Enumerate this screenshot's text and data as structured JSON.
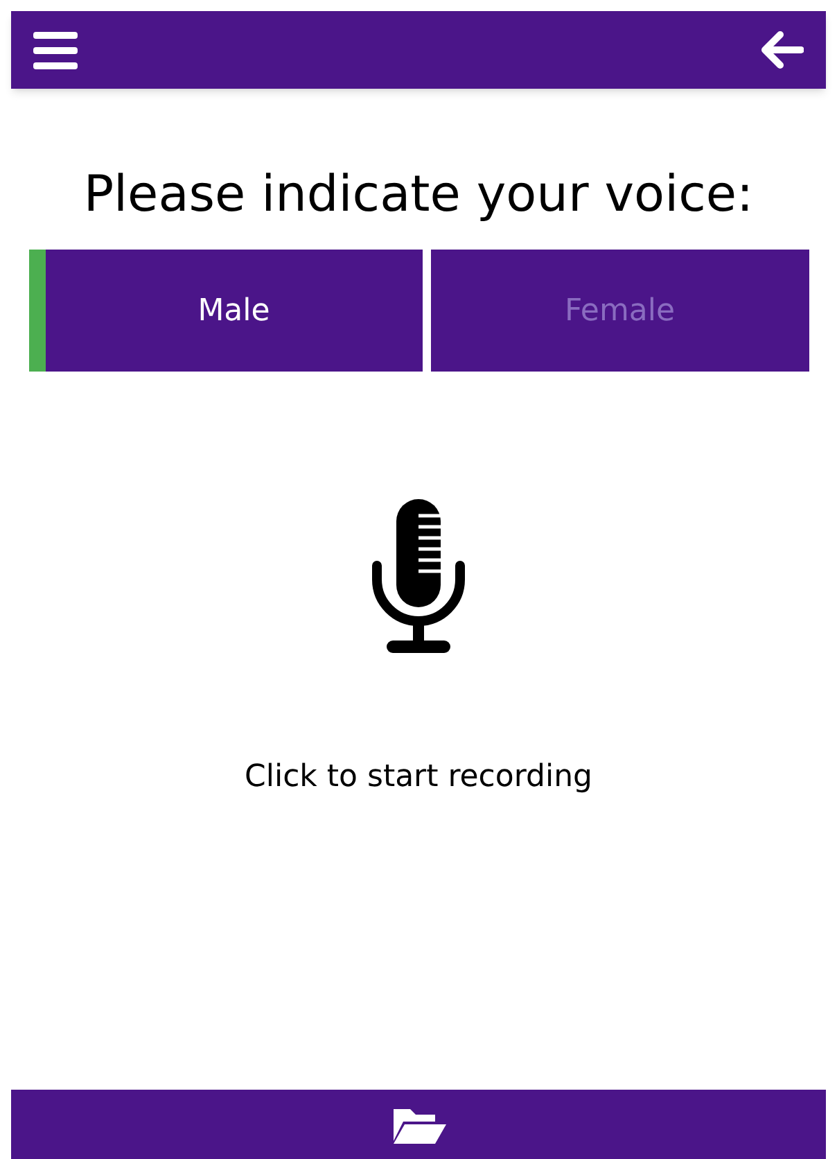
{
  "heading": "Please indicate your voice:",
  "options": [
    {
      "label": "Male",
      "selected": true
    },
    {
      "label": "Female",
      "selected": false
    }
  ],
  "prompt": "Click to start recording"
}
